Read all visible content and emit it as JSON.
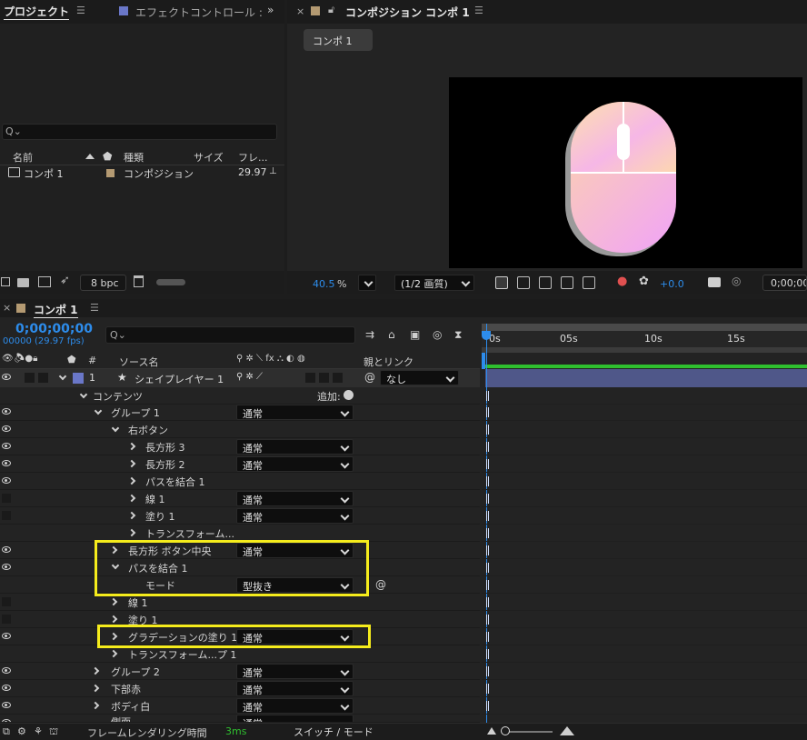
{
  "project_panel": {
    "tab_title": "プロジェクト",
    "effect_tab": "エフェクトコントロール :",
    "search_placeholder": "Q⌄",
    "col_name": "名前",
    "col_type": "種類",
    "col_size": "サイズ",
    "col_fps": "フレ...",
    "item": {
      "name": "コンポ 1",
      "type": "コンポジション",
      "fps": "29.97"
    },
    "bpc": "8 bpc"
  },
  "comp_viewer": {
    "tab_title": "コンポジション コンポ 1",
    "breadcrumb": "コンポ 1",
    "zoom": "40.5",
    "zoom_unit": "%",
    "resolution": "(1/2 画質)",
    "exposure": "+0.0",
    "timecode": "0;00;00;0"
  },
  "timeline": {
    "tab_title": "コンポ 1",
    "timecode": "0;00;00;00",
    "frame_info": "00000 (29.97 fps)",
    "search_placeholder": "Q⌄",
    "col_hash": "#",
    "col_source": "ソース名",
    "col_parent": "親とリンク",
    "ruler": [
      "0s",
      "05s",
      "10s",
      "15s"
    ],
    "layer": {
      "num": "1",
      "name": "シェイプレイヤー 1",
      "parent": "なし"
    },
    "contents_label": "コンテンツ",
    "add_label": "追加:",
    "rows": [
      {
        "label": "グループ 1",
        "mode": "通常"
      },
      {
        "label": "右ボタン",
        "mode": ""
      },
      {
        "label": "長方形 3",
        "mode": "通常"
      },
      {
        "label": "長方形 2",
        "mode": "通常"
      },
      {
        "label": "パスを結合 1",
        "mode": ""
      },
      {
        "label": "線 1",
        "mode": "通常"
      },
      {
        "label": "塗り 1",
        "mode": "通常"
      },
      {
        "label": "トランスフォーム...",
        "mode": ""
      },
      {
        "label": "長方形 ボタン中央",
        "mode": "通常"
      },
      {
        "label": "パスを結合 1",
        "mode": ""
      },
      {
        "label": "モード",
        "mode": "型抜き"
      },
      {
        "label": "線 1",
        "mode": ""
      },
      {
        "label": "塗り 1",
        "mode": ""
      },
      {
        "label": "グラデーションの塗り 1",
        "mode": "通常"
      },
      {
        "label": "トランスフォーム...プ 1",
        "mode": ""
      },
      {
        "label": "グループ 2",
        "mode": "通常"
      },
      {
        "label": "下部赤",
        "mode": "通常"
      },
      {
        "label": "ボディ白",
        "mode": "通常"
      },
      {
        "label": "側面",
        "mode": "通常"
      }
    ],
    "footer_render": "フレームレンダリング時間",
    "footer_ms": "3ms",
    "footer_switch": "スイッチ / モード"
  },
  "colors": {
    "accent": "#2d8ceb",
    "highlight": "#f5ec1c",
    "layer_bar": "#4f5789",
    "label_purple": "#6a77c8",
    "label_tan": "#b49a72",
    "green_bar": "#2fc02f"
  }
}
